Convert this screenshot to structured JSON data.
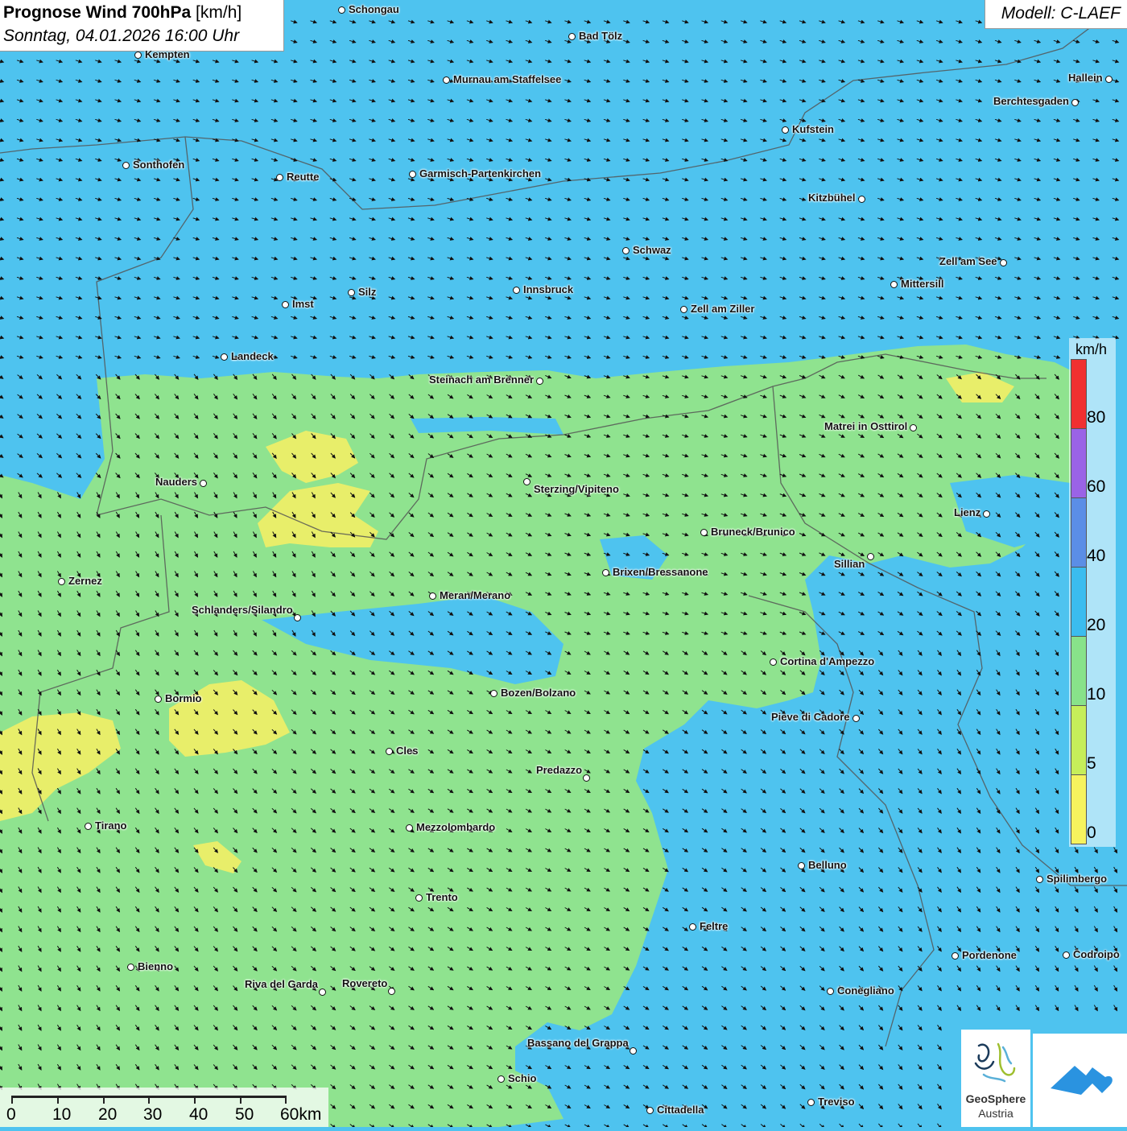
{
  "title": {
    "main_bold": "Prognose Wind 700hPa",
    "main_unit": " [km/h]",
    "subtitle": "Sonntag, 04.01.2026 16:00 Uhr"
  },
  "model": "Modell: C-LAEF",
  "legend": {
    "unit": "km/h",
    "labels": [
      "80",
      "60",
      "40",
      "20",
      "10",
      "5",
      "0"
    ],
    "colors": [
      "#f03030",
      "#9a63e6",
      "#5b8ee6",
      "#3bbcef",
      "#88e28a",
      "#c6ee5a",
      "#f6f35e"
    ]
  },
  "scale_bar": {
    "labels": [
      "0",
      "10",
      "20",
      "30",
      "40",
      "50",
      "60km"
    ]
  },
  "logos": {
    "geosphere_line1": "GeoSphere",
    "geosphere_line2": "Austria"
  },
  "cities": [
    "Schongau",
    "Bad Tölz",
    "Kempten",
    "Murnau am Staffelsee",
    "Hallein",
    "Berchtesgaden",
    "Kufstein",
    "Sonthofen",
    "Reutte",
    "Garmisch-Partenkirchen",
    "Kitzbühel",
    "Schwaz",
    "Zell am See",
    "Mittersill",
    "Innsbruck",
    "Silz",
    "Imst",
    "Zell am Ziller",
    "Landeck",
    "Steinach am Brenner",
    "Matrei in Osttirol",
    "Nauders",
    "Sterzing/Vipiteno",
    "Lienz",
    "Bruneck/Brunico",
    "Sillian",
    "Zernez",
    "Brixen/Bressanone",
    "Meran/Merano",
    "Schlanders/Silandro",
    "Cortina d'Ampezzo",
    "Bozen/Bolzano",
    "Bormio",
    "Pieve di Cadore",
    "Cles",
    "Predazzo",
    "Tirano",
    "Mezzolombardo",
    "Belluno",
    "Spilimbergo",
    "Trento",
    "Feltre",
    "Bienno",
    "Pordenone",
    "Codroipo",
    "Riva del Garda",
    "Rovereto",
    "Conegliano",
    "Bassano del Grappa",
    "Schio",
    "Treviso",
    "Cittadella"
  ],
  "colors": {
    "wind_10_20": "#8fe38f",
    "wind_20_40": "#4ec3ef",
    "wind_5_10": "#e8ee6a",
    "border": "#555555"
  }
}
